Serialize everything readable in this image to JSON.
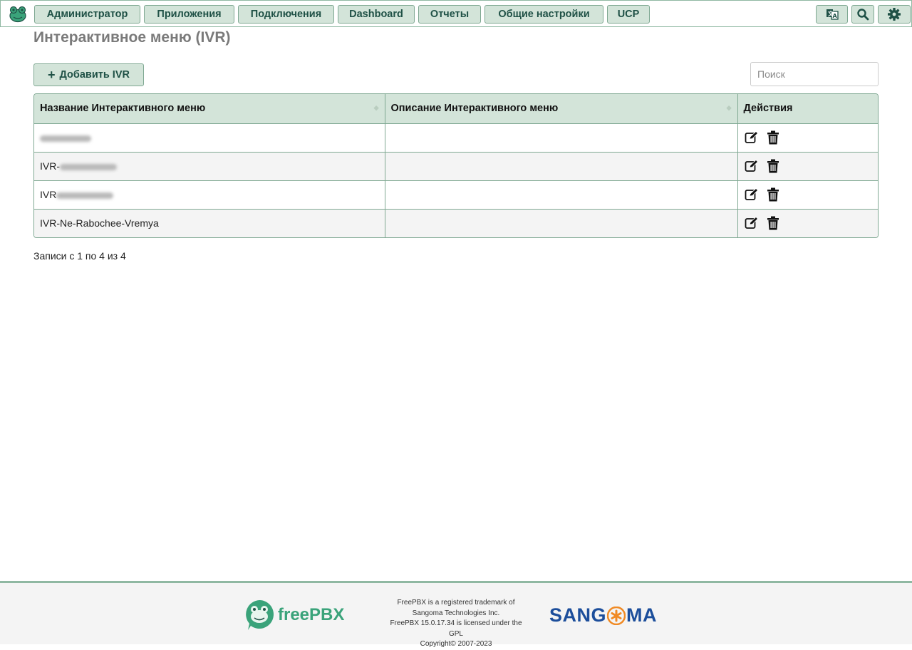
{
  "nav": {
    "items": [
      {
        "label": "Администратор"
      },
      {
        "label": "Приложения"
      },
      {
        "label": "Подключения"
      },
      {
        "label": "Dashboard"
      },
      {
        "label": "Отчеты"
      },
      {
        "label": "Общие настройки"
      },
      {
        "label": "UCP"
      }
    ],
    "icons": [
      "language-icon",
      "search-icon",
      "gear-icon"
    ]
  },
  "page": {
    "title": "Интерактивное меню (IVR)"
  },
  "toolbar": {
    "add_label": "Добавить IVR",
    "search_placeholder": "Поиск"
  },
  "table": {
    "headers": [
      "Название Интерактивного меню",
      "Описание Интерактивного меню",
      "Действия"
    ],
    "rows": [
      {
        "name_prefix": "",
        "name": "",
        "description": "",
        "redacted": true
      },
      {
        "name_prefix": "IVR-",
        "name": "",
        "description": "",
        "redacted": true
      },
      {
        "name_prefix": "IVR",
        "name": "",
        "description": "",
        "redacted": true
      },
      {
        "name_prefix": "",
        "name": "IVR-Ne-Rabochee-Vremya",
        "description": "",
        "redacted": false
      }
    ]
  },
  "pagination": {
    "info": "Записи с 1 по 4 из 4"
  },
  "footer": {
    "brand": "freePBX",
    "legal_lines": [
      "FreePBX is a registered trademark of",
      "Sangoma Technologies Inc.",
      "FreePBX 15.0.17.34 is licensed under the",
      "GPL",
      "Copyright© 2007-2023"
    ],
    "sangoma_left": "SANG",
    "sangoma_right": "MA"
  },
  "colors": {
    "accent": "#d3e4d9",
    "border": "#7fa892",
    "text_dark_green": "#1f5146",
    "sangoma_blue": "#1c4e9b",
    "sangoma_orange": "#f08a24"
  }
}
